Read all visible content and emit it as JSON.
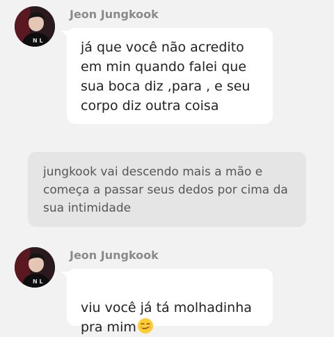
{
  "messages": [
    {
      "sender": "Jeon Jungkook",
      "text": "já que você não acredito\nem min quando falei que\nsua boca diz ,para , e seu\ncorpo diz outra coisa"
    },
    {
      "narration": "jungkook vai descendo mais a mão e\ncomeça a passar seus dedos por cima da\nsua intimidade"
    },
    {
      "sender": "Jeon Jungkook",
      "text": "viu você já tá molhadinha\npra mim",
      "emoji": "smirking-face-emoji"
    }
  ],
  "colors": {
    "background": "#f2f2f2",
    "bubble": "#ffffff",
    "narration_bg": "#e5e5e5",
    "sender": "#8a8a8a",
    "text": "#222222"
  }
}
